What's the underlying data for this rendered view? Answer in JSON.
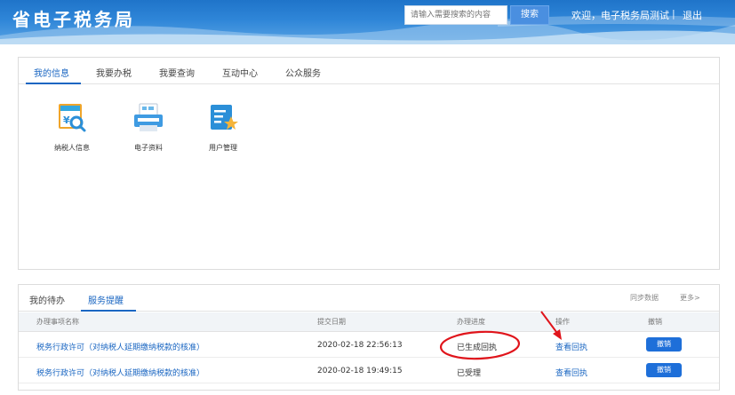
{
  "header": {
    "site_title": "省电子税务局",
    "search_placeholder": "请输入需要搜索的内容",
    "search_button": "搜索",
    "welcome": "欢迎，电子税务局测试",
    "separator": "|",
    "logout": "退出"
  },
  "info_panel": {
    "tabs": [
      {
        "label": "我的信息",
        "active": true
      },
      {
        "label": "我要办税",
        "active": false
      },
      {
        "label": "我要查询",
        "active": false
      },
      {
        "label": "互动中心",
        "active": false
      },
      {
        "label": "公众服务",
        "active": false
      }
    ],
    "apps": [
      {
        "label": "纳税人信息",
        "icon": "taxpayer-info-icon"
      },
      {
        "label": "电子资料",
        "icon": "electronic-documents-icon"
      },
      {
        "label": "用户管理",
        "icon": "user-management-icon"
      }
    ]
  },
  "todo_panel": {
    "tabs": [
      {
        "label": "我的待办",
        "active": false
      },
      {
        "label": "服务提醒",
        "active": true
      }
    ],
    "sync_label": "同步数据",
    "more_label": "更多>",
    "columns": [
      "办理事项名称",
      "提交日期",
      "办理进度",
      "操作",
      "撤销"
    ],
    "rows": [
      {
        "name": "税务行政许可（对纳税人延期缴纳税款的核准）",
        "date": "2020-02-18 22:56:13",
        "status": "已生成回执",
        "action": "查看回执",
        "cancel": "撤销"
      },
      {
        "name": "税务行政许可（对纳税人延期缴纳税款的核准）",
        "date": "2020-02-18 19:49:15",
        "status": "已受理",
        "action": "查看回执",
        "cancel": "撤销"
      }
    ]
  },
  "colors": {
    "banner": "#2f86d8",
    "accent": "#1a66c2",
    "button": "#1e6fd9",
    "annotation": "#e0141b"
  }
}
